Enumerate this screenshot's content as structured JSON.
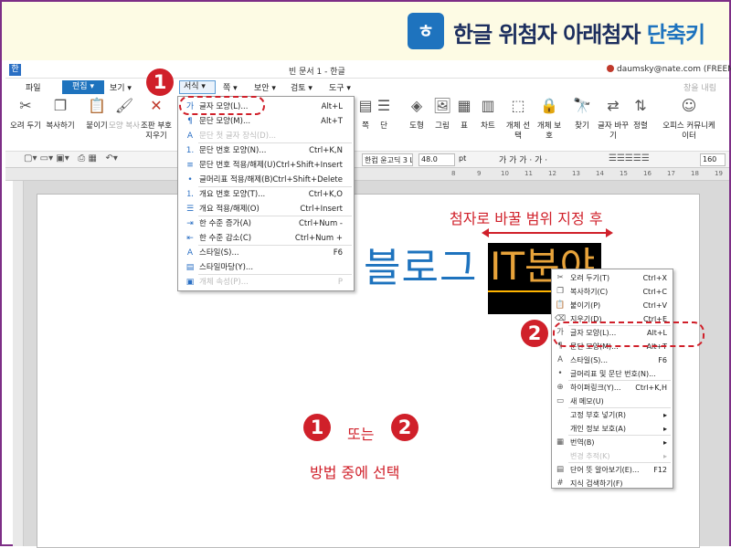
{
  "banner": {
    "title_main": "한글 위첨자 아래첨자 ",
    "title_accent": "단축키",
    "icon": "hwp-logo-icon",
    "icon_glyph": "ㅎ"
  },
  "window": {
    "app_icon_glyph": "한",
    "title": "빈 문서 1 - 한글",
    "user_email": "daumsky@nate.com (FREEMIL"
  },
  "menubar": {
    "items": [
      "파일",
      "편집",
      "보기",
      "서식",
      "쪽",
      "보안",
      "검토",
      "도구"
    ],
    "hint": "창을 내림"
  },
  "toolbar": {
    "buttons": [
      "오려 두기",
      "복사하기",
      "붙이기",
      "모양 복사",
      "조판 부호 지우기",
      "쪽",
      "단",
      "도형",
      "그림",
      "표",
      "차트",
      "개체 선택",
      "개체 보호",
      "찾기",
      "글자 바꾸기",
      "정렬",
      "오피스 커뮤니케이터"
    ]
  },
  "format_bar": {
    "font": "한컴 윤고딕 3 Li",
    "size": "48.0",
    "unit": "pt",
    "styles": "가 가 가 · 가 ·",
    "zoom": "160"
  },
  "ruler": {
    "ticks": [
      "8",
      "9",
      "10",
      "11",
      "12",
      "13",
      "14",
      "15",
      "16",
      "17",
      "18",
      "19"
    ]
  },
  "format_menu": {
    "items": [
      {
        "label": "글자 모양(L)...",
        "shortcut": "Alt+L",
        "icon": "char-shape-icon",
        "enabled": true
      },
      {
        "label": "문단 모양(M)...",
        "shortcut": "Alt+T",
        "icon": "para-shape-icon",
        "enabled": true
      },
      {
        "label": "문단 첫 글자 장식(D)...",
        "shortcut": "",
        "icon": "dropcap-icon",
        "enabled": false
      },
      {
        "label": "문단 번호 모양(N)...",
        "shortcut": "Ctrl+K,N",
        "icon": "para-number-icon",
        "enabled": true
      },
      {
        "label": "문단 번호 적용/해제(U)",
        "shortcut": "Ctrl+Shift+Insert",
        "icon": "para-number-toggle-icon",
        "enabled": true
      },
      {
        "label": "글머리표 적용/해제(B)",
        "shortcut": "Ctrl+Shift+Delete",
        "icon": "bullet-icon",
        "enabled": true
      },
      {
        "label": "개요 번호 모양(T)...",
        "shortcut": "Ctrl+K,O",
        "icon": "outline-number-icon",
        "enabled": true
      },
      {
        "label": "개요 적용/해제(O)",
        "shortcut": "Ctrl+Insert",
        "icon": "outline-toggle-icon",
        "enabled": true
      },
      {
        "label": "한 수준 증가(A)",
        "shortcut": "Ctrl+Num -",
        "icon": "indent-icon",
        "enabled": true
      },
      {
        "label": "한 수준 감소(C)",
        "shortcut": "Ctrl+Num +",
        "icon": "outdent-icon",
        "enabled": true
      },
      {
        "label": "스타일(S)...",
        "shortcut": "F6",
        "icon": "style-icon",
        "enabled": true
      },
      {
        "label": "스타일마당(Y)...",
        "shortcut": "",
        "icon": "style-gallery-icon",
        "enabled": true
      },
      {
        "label": "개체 속성(P)...",
        "shortcut": "P",
        "icon": "object-props-icon",
        "enabled": false
      }
    ]
  },
  "callouts": {
    "badge1": "1",
    "badge2": "2",
    "range_hint": "첨자로 바꿀 범위 지정 후",
    "instruction_or": "또는",
    "instruction_select": "방법 중에 선택"
  },
  "document": {
    "text_blue": "블로그",
    "text_selected": "IT분야"
  },
  "context_menu": {
    "items": [
      {
        "label": "오려 두기(T)",
        "shortcut": "Ctrl+X",
        "icon": "scissors-icon",
        "enabled": true
      },
      {
        "label": "복사하기(C)",
        "shortcut": "Ctrl+C",
        "icon": "copy-icon",
        "enabled": true
      },
      {
        "label": "붙이기(P)",
        "shortcut": "Ctrl+V",
        "icon": "paste-icon",
        "enabled": true
      },
      {
        "label": "지우기(D)",
        "shortcut": "Ctrl+E",
        "icon": "eraser-icon",
        "enabled": true
      },
      {
        "label": "글자 모양(L)...",
        "shortcut": "Alt+L",
        "icon": "char-shape-icon",
        "enabled": true
      },
      {
        "label": "문단 모양(M)...",
        "shortcut": "Alt+T",
        "icon": "para-shape-icon",
        "enabled": true
      },
      {
        "label": "스타일(S)...",
        "shortcut": "F6",
        "icon": "style-icon",
        "enabled": true
      },
      {
        "label": "글머리표 및 문단 번호(N)...",
        "shortcut": "",
        "icon": "bullet-icon",
        "enabled": true
      },
      {
        "label": "하이퍼링크(Y)...",
        "shortcut": "Ctrl+K,H",
        "icon": "hyperlink-icon",
        "enabled": true
      },
      {
        "label": "새 메모(U)",
        "shortcut": "",
        "icon": "memo-icon",
        "enabled": true
      },
      {
        "label": "고정 부호 넣기(R)",
        "shortcut": "▸",
        "icon": "",
        "enabled": true
      },
      {
        "label": "개인 정보 보호(A)",
        "shortcut": "▸",
        "icon": "",
        "enabled": true
      },
      {
        "label": "번역(B)",
        "shortcut": "▸",
        "icon": "translate-icon",
        "enabled": true
      },
      {
        "label": "변경 추적(K)",
        "shortcut": "▸",
        "icon": "",
        "enabled": false
      },
      {
        "label": "단어 뜻 알아보기(E)...",
        "shortcut": "F12",
        "icon": "dictionary-icon",
        "enabled": true
      },
      {
        "label": "지식 검색하기(F)",
        "shortcut": "",
        "icon": "hash-icon",
        "enabled": true
      }
    ]
  }
}
